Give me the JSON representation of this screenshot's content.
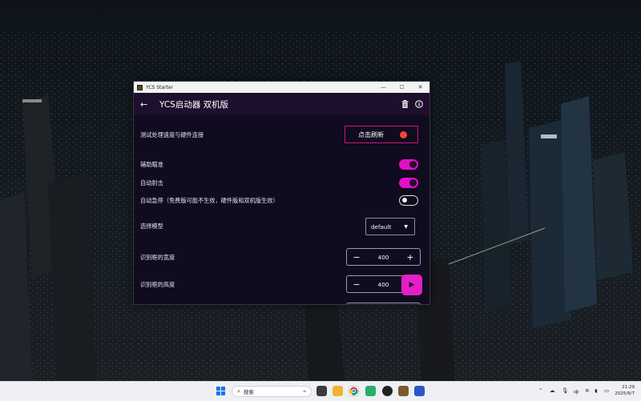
{
  "window": {
    "title": "YCS Starter",
    "controls": {
      "minimize": "—",
      "maximize": "☐",
      "close": "✕"
    }
  },
  "appbar": {
    "back_icon": "arrow-left-icon",
    "heading": "YCS启动器 双机版",
    "delete_icon": "trash-icon",
    "info_icon": "info-icon"
  },
  "settings": {
    "connection": {
      "label": "测试处理速度与硬件连接",
      "button_label": "点击刷新",
      "status_color": "#f44336"
    },
    "aim_assist": {
      "label": "辅助瞄准",
      "on": true
    },
    "auto_fire": {
      "label": "自动射击",
      "on": true
    },
    "auto_stop": {
      "label": "自动急停（免费版可能不生效，硬件版和双机版生效）",
      "on": false
    },
    "model": {
      "label": "选择模型",
      "selected": "default"
    },
    "box_width": {
      "label": "识别框的宽度",
      "value": "400"
    },
    "box_height": {
      "label": "识别框的高度",
      "value": "400"
    }
  },
  "fab": {
    "icon": "play-icon"
  },
  "taskbar": {
    "search_placeholder": "搜索",
    "ime": "中",
    "time": "21:29",
    "date": "2025/9/7"
  },
  "colors": {
    "accent": "#e010c8",
    "window_bg": "#100b1f",
    "appbar_bg": "#1d0f2d"
  }
}
